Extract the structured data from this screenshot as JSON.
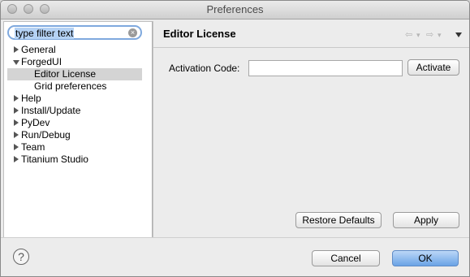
{
  "window": {
    "title": "Preferences"
  },
  "filter": {
    "text": "type filter text"
  },
  "tree": [
    {
      "label": "General",
      "expanded": false,
      "indent": 0
    },
    {
      "label": "ForgedUI",
      "expanded": true,
      "indent": 0
    },
    {
      "label": "Editor License",
      "indent": 1,
      "selected": true
    },
    {
      "label": "Grid preferences",
      "indent": 1
    },
    {
      "label": "Help",
      "expanded": false,
      "indent": 0
    },
    {
      "label": "Install/Update",
      "expanded": false,
      "indent": 0
    },
    {
      "label": "PyDev",
      "expanded": false,
      "indent": 0
    },
    {
      "label": "Run/Debug",
      "expanded": false,
      "indent": 0
    },
    {
      "label": "Team",
      "expanded": false,
      "indent": 0
    },
    {
      "label": "Titanium Studio",
      "expanded": false,
      "indent": 0
    }
  ],
  "page": {
    "title": "Editor License",
    "activation_label": "Activation Code:",
    "activation_value": "",
    "activate_button": "Activate",
    "restore_button": "Restore Defaults",
    "apply_button": "Apply"
  },
  "footer": {
    "help_icon": "?",
    "cancel_button": "Cancel",
    "ok_button": "OK"
  },
  "nav": {
    "back_icon": "⇦",
    "forward_icon": "⇨",
    "dropdown_icon": "▾"
  }
}
